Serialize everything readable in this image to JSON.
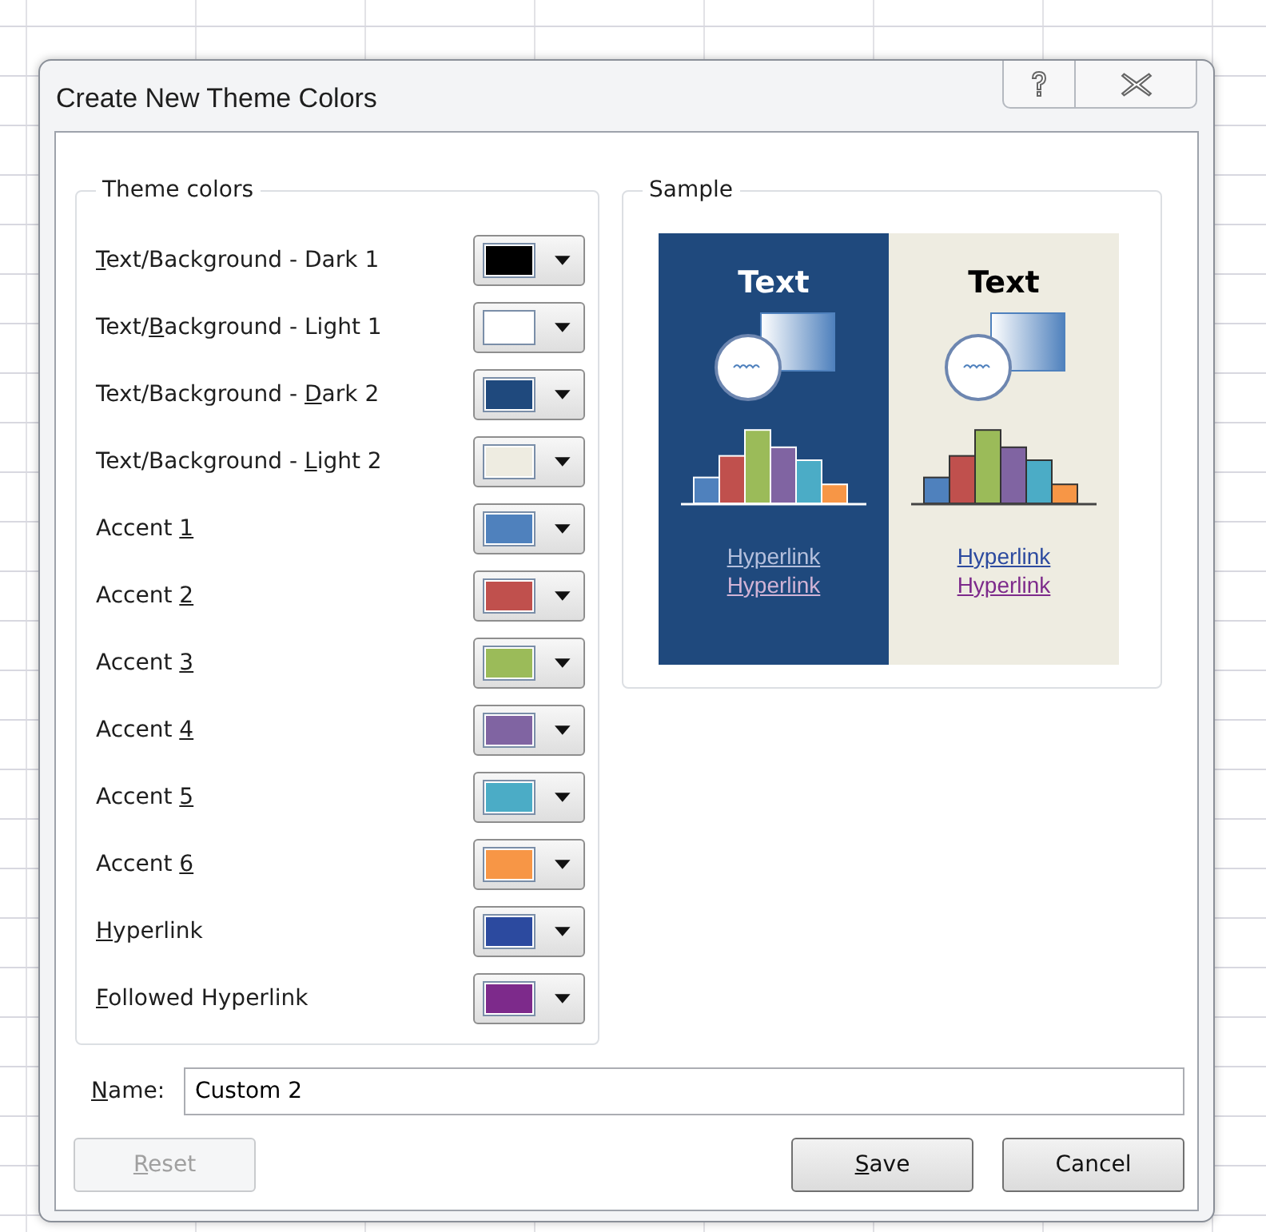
{
  "window": {
    "title": "Create New Theme Colors"
  },
  "theme_colors": {
    "title": "Theme colors",
    "items": [
      {
        "key": "T",
        "after": "ext/Background - Dark 1",
        "color": "#000000"
      },
      {
        "before": "Text/",
        "key": "B",
        "after": "ackground - Light 1",
        "color": "#ffffff"
      },
      {
        "before": "Text/Background - ",
        "key": "D",
        "after": "ark 2",
        "color": "#1f497d"
      },
      {
        "before": "Text/Background - ",
        "key": "L",
        "after": "ight 2",
        "color": "#eeece1"
      },
      {
        "before": "Accent ",
        "key": "1",
        "color": "#4f81bd"
      },
      {
        "before": "Accent ",
        "key": "2",
        "color": "#c0504d"
      },
      {
        "before": "Accent ",
        "key": "3",
        "color": "#9bbb59"
      },
      {
        "before": "Accent ",
        "key": "4",
        "color": "#8064a2"
      },
      {
        "before": "Accent ",
        "key": "5",
        "color": "#4bacc6"
      },
      {
        "before": "Accent ",
        "key": "6",
        "color": "#f79646"
      },
      {
        "key": "H",
        "after": "yperlink",
        "color": "#2c4a9f"
      },
      {
        "key": "F",
        "after": "ollowed Hyperlink",
        "color": "#7d2a8b"
      }
    ]
  },
  "sample": {
    "title": "Sample",
    "panels": [
      {
        "kind": "dark",
        "heading": "Text",
        "links": [
          "Hyperlink",
          "Hyperlink"
        ]
      },
      {
        "kind": "light",
        "heading": "Text",
        "links": [
          "Hyperlink",
          "Hyperlink"
        ]
      }
    ]
  },
  "name_field": {
    "label": {
      "key": "N",
      "after": "ame:"
    },
    "value": "Custom 2"
  },
  "buttons": [
    {
      "key": "R",
      "after": "eset",
      "disabled": true
    },
    {
      "key": "S",
      "after": "ave",
      "disabled": false
    },
    {
      "before": "Cancel",
      "disabled": false
    }
  ]
}
